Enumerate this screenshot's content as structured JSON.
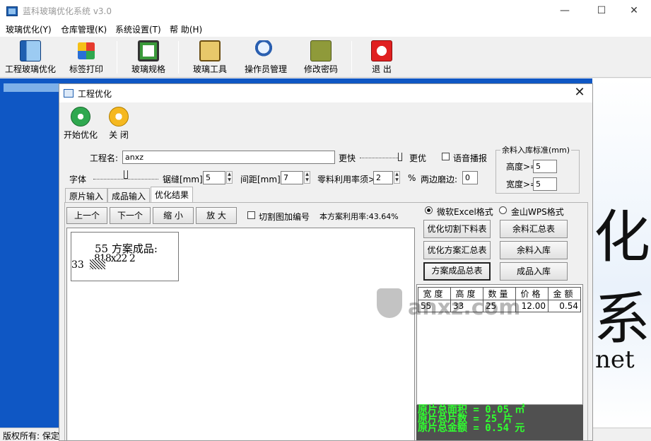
{
  "app": {
    "title": "蓝科玻璃优化系统 v3.0"
  },
  "window_controls": {
    "minimize": "—",
    "maximize": "☐",
    "close": "✕"
  },
  "menu": [
    "玻璃优化(Y)",
    "仓库管理(K)",
    "系统设置(T)",
    "帮 助(H)"
  ],
  "toolbar": [
    {
      "label": "工程玻璃优化",
      "icon": "glass-panel-icon"
    },
    {
      "label": "标签打印",
      "icon": "label-print-icon"
    },
    {
      "label": "玻璃规格",
      "icon": "glass-spec-icon"
    },
    {
      "label": "玻璃工具",
      "icon": "glass-tool-icon"
    },
    {
      "label": "操作员管理",
      "icon": "operator-icon"
    },
    {
      "label": "修改密码",
      "icon": "key-icon"
    },
    {
      "label": "退 出",
      "icon": "exit-icon"
    }
  ],
  "desktop": {
    "brand_char": "化系",
    "brand_suffix": "net",
    "colors": {
      "desktop_blue": "#0f57c4"
    }
  },
  "statusbar": {
    "text": "版权所有: 保定"
  },
  "dialog": {
    "title": "工程优化",
    "close": "✕",
    "actions": {
      "start": "开始优化",
      "close": "关 闭"
    },
    "project_label": "工程名:",
    "project_value": "anxz",
    "speed_fast": "更快",
    "speed_best": "更优",
    "voice_label": "语音播报",
    "font_label": "字体",
    "kerf_label": "锯缝[mm]:",
    "kerf_value": "5",
    "gap_label": "间距[mm]:",
    "gap_value": "7",
    "usage_label": "零料利用率须>",
    "usage_value": "2",
    "usage_unit": "%",
    "edge_label": "两边磨边:",
    "edge_value": "0",
    "remnant_group": {
      "title": "余料入库标准(mm)",
      "height_label": "高度>=",
      "height_value": "5",
      "width_label": "宽度>=",
      "width_value": "5"
    },
    "tabs": [
      "原片输入",
      "成品输入",
      "优化结果"
    ],
    "nav": {
      "prev": "上一个",
      "next": "下一个",
      "zoom_out": "缩 小",
      "zoom_in": "放 大"
    },
    "cut_number_label": "切割图加编号",
    "usage_rate": "本方案利用率:43.64%",
    "format": {
      "excel": "微软Excel格式",
      "wps": "金山WPS格式"
    },
    "buttons": {
      "cut_list": "优化切割下料表",
      "remnant_summary": "余料汇总表",
      "plan_summary": "优化方案汇总表",
      "remnant_store": "余料入库",
      "product_summary": "方案成品总表",
      "product_store": "成品入库"
    },
    "preview": {
      "line1": "55 方案成品:",
      "line2": "818x22 2",
      "line3": "33"
    },
    "table": {
      "headers": [
        "宽度",
        "高度",
        "数量",
        "价格",
        "金额"
      ],
      "rows": [
        [
          "55",
          "33",
          "25",
          "12.00",
          "0.54"
        ]
      ]
    },
    "summary": [
      "原片总面积 = 0.05 ㎡",
      "原片总片数 = 25 片",
      "原片总金额 = 0.54 元"
    ],
    "watermark": "anxz.com"
  }
}
